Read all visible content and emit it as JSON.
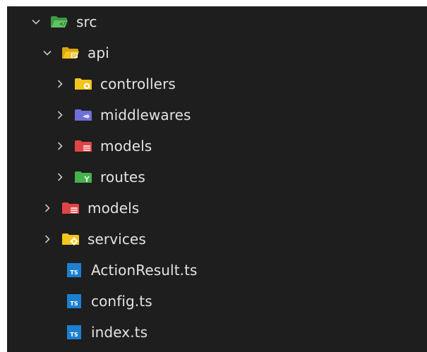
{
  "tree": {
    "src": {
      "label": "src",
      "icon": "folder-src-open-icon"
    },
    "api": {
      "label": "api",
      "icon": "folder-api-open-icon"
    },
    "controllers": {
      "label": "controllers",
      "icon": "folder-controller-icon"
    },
    "middlewares": {
      "label": "middlewares",
      "icon": "folder-middleware-icon"
    },
    "models_api": {
      "label": "models",
      "icon": "folder-database-icon"
    },
    "routes": {
      "label": "routes",
      "icon": "folder-routes-icon"
    },
    "models_src": {
      "label": "models",
      "icon": "folder-database-icon"
    },
    "services": {
      "label": "services",
      "icon": "folder-services-icon"
    },
    "files": [
      {
        "label": "ActionResult.ts",
        "icon": "typescript-file-icon"
      },
      {
        "label": "config.ts",
        "icon": "typescript-file-icon"
      },
      {
        "label": "index.ts",
        "icon": "typescript-file-icon"
      }
    ],
    "ts_badge": "TS"
  },
  "colors": {
    "background": "#1e1e1e",
    "text": "#e3e3e3",
    "chevron": "#c5c5c5",
    "folder_yellow": "#f4c51d",
    "folder_purple": "#6f6fd9",
    "folder_red": "#e04545",
    "folder_green": "#45b24d",
    "typescript_blue": "#1d7fd2"
  }
}
